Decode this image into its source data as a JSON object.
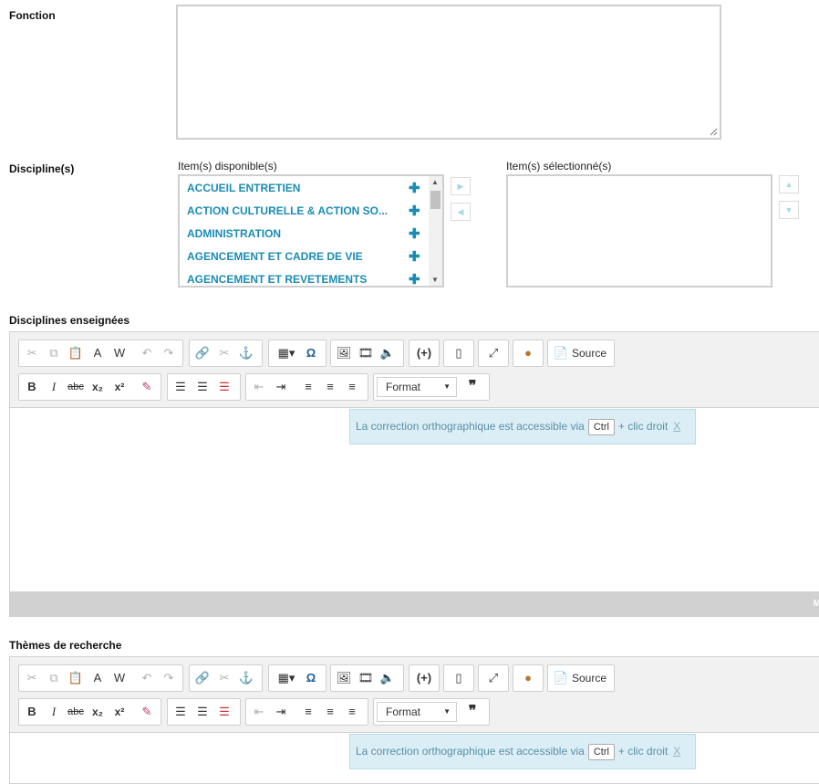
{
  "fields": {
    "fonction": {
      "label": "Fonction"
    },
    "disciplines": {
      "label": "Discipline(s)",
      "available_label": "Item(s) disponible(s)",
      "selected_label": "Item(s) sélectionné(s)",
      "available_items": [
        "ACCUEIL ENTRETIEN",
        "ACTION CULTURELLE & ACTION SO...",
        "ADMINISTRATION",
        "AGENCEMENT ET CADRE DE VIE",
        "AGENCEMENT ET REVETEMENTS"
      ],
      "add_symbol": "✚"
    },
    "disciplines_enseignees": {
      "label": "Disciplines enseignées"
    },
    "themes_recherche": {
      "label": "Thèmes de recherche"
    }
  },
  "editor": {
    "source_label": "Source",
    "format_label": "Format",
    "bold": "B",
    "italic": "I",
    "strike": "abc",
    "subscript": "x₂",
    "superscript": "x²",
    "quote": "❞",
    "notice": {
      "text_before": "La correction orthographique est accessible via",
      "key": "Ctrl",
      "text_after": "+ clic droit",
      "close": "X"
    },
    "status_cut": "M"
  },
  "icons": [
    "cut-icon",
    "copy-icon",
    "paste-icon",
    "paste-text-icon",
    "paste-word-icon",
    "undo-icon",
    "redo-icon",
    "link-icon",
    "unlink-icon",
    "anchor-icon",
    "table-icon",
    "special-char-icon",
    "image-icon",
    "video-icon",
    "audio-icon",
    "placeholder-icon",
    "page-break-icon",
    "maximize-icon",
    "cookie-icon",
    "source-icon",
    "remove-format-icon",
    "numbered-list-icon",
    "bullet-list-icon",
    "checklist-icon",
    "outdent-icon",
    "indent-icon",
    "align-left-icon",
    "align-center-icon",
    "align-right-icon"
  ]
}
